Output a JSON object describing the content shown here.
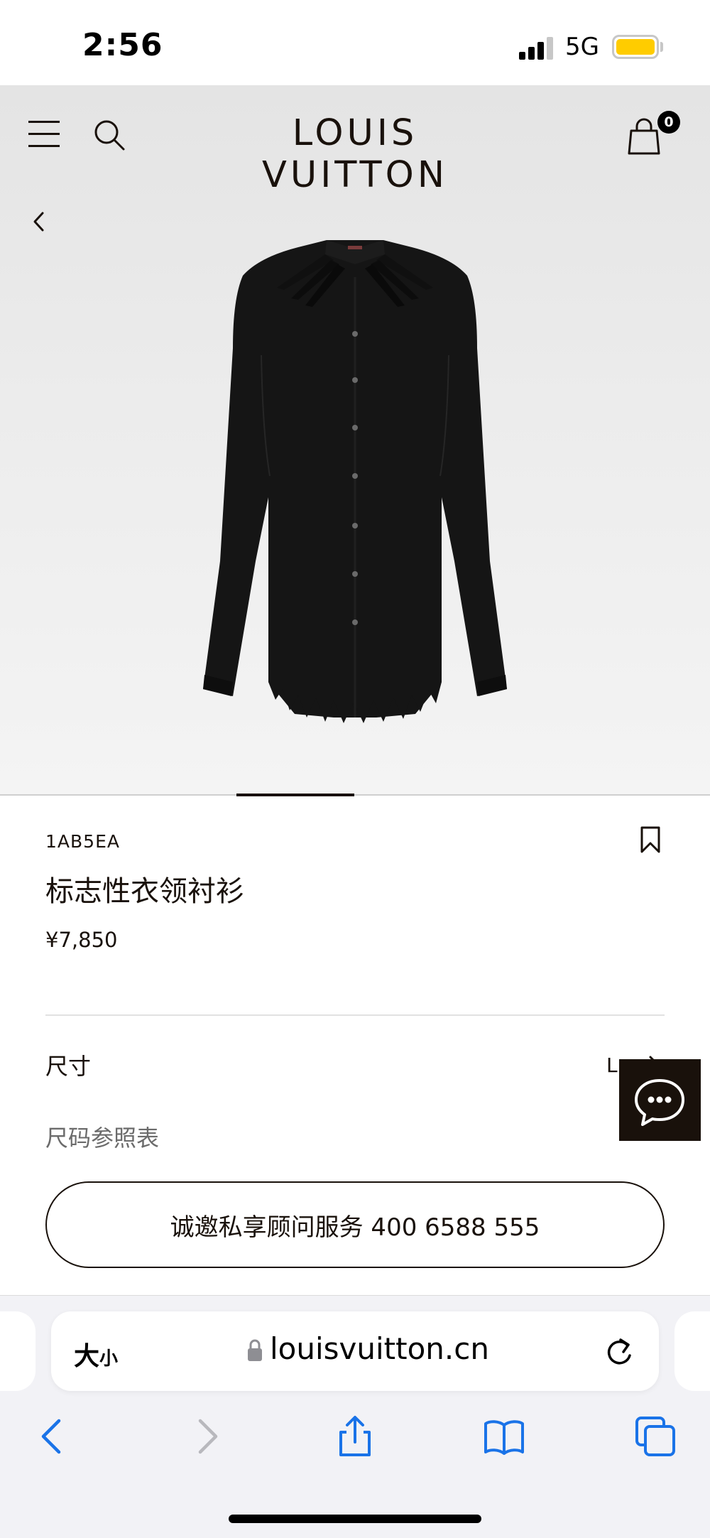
{
  "status_bar": {
    "time": "2:56",
    "network": "5G",
    "battery_color": "#ffcc00"
  },
  "header": {
    "brand": "LOUIS VUITTON",
    "bag_count": "0",
    "icons": [
      "menu-icon",
      "search-icon",
      "bag-icon",
      "back-icon"
    ]
  },
  "carousel": {
    "current_index": 3,
    "total": 6
  },
  "product": {
    "sku": "1AB5EA",
    "name": "标志性衣领衬衫",
    "price": "¥7,850",
    "size_label": "尺寸",
    "size_value": "L",
    "size_guide": "尺码参照表",
    "advisor_button": "诚邀私享顾问服务 400 6588 555"
  },
  "browser": {
    "text_size_big": "大",
    "text_size_small": "小",
    "url": "louisvuitton.cn",
    "accent_color": "#1a73e8",
    "nav_icons": [
      "back-icon",
      "forward-icon",
      "share-icon",
      "bookmarks-icon",
      "tabs-icon"
    ]
  }
}
